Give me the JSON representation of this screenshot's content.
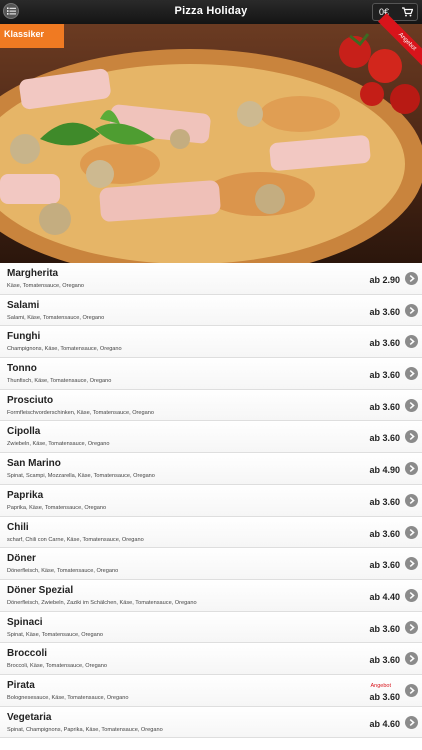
{
  "header": {
    "title": "Pizza Holiday",
    "cart_total": "0€"
  },
  "hero": {
    "category_tab": "Klassiker",
    "ribbon": "Angebot"
  },
  "items": [
    {
      "name": "Margherita",
      "desc": "Käse, Tomatensauce, Oregano",
      "price": "ab 2.90",
      "badge": ""
    },
    {
      "name": "Salami",
      "desc": "Salami, Käse, Tomatensauce, Oregano",
      "price": "ab 3.60",
      "badge": ""
    },
    {
      "name": "Funghi",
      "desc": "Champignons, Käse, Tomatensauce, Oregano",
      "price": "ab 3.60",
      "badge": ""
    },
    {
      "name": "Tonno",
      "desc": "Thunfisch, Käse, Tomatensauce, Oregano",
      "price": "ab 3.60",
      "badge": ""
    },
    {
      "name": "Prosciuto",
      "desc": "Formfleischvorderschinken, Käse, Tomatensauce, Oregano",
      "price": "ab 3.60",
      "badge": ""
    },
    {
      "name": "Cipolla",
      "desc": "Zwiebeln, Käse, Tomatensauce, Oregano",
      "price": "ab 3.60",
      "badge": ""
    },
    {
      "name": "San Marino",
      "desc": "Spinat, Scampi, Mozzarella, Käse, Tomatensauce, Oregano",
      "price": "ab 4.90",
      "badge": ""
    },
    {
      "name": "Paprika",
      "desc": "Paprika, Käse, Tomatensauce, Oregano",
      "price": "ab 3.60",
      "badge": ""
    },
    {
      "name": "Chili",
      "desc": "scharf, Chili con Carne, Käse, Tomatensauce, Oregano",
      "price": "ab 3.60",
      "badge": ""
    },
    {
      "name": "Döner",
      "desc": "Dönerfleisch, Käse, Tomatensauce, Oregano",
      "price": "ab 3.60",
      "badge": ""
    },
    {
      "name": "Döner Spezial",
      "desc": "Dönerfleisch, Zwiebeln, Zaziki im Schälchen, Käse, Tomatensauce, Oregano",
      "price": "ab 4.40",
      "badge": ""
    },
    {
      "name": "Spinaci",
      "desc": "Spinat, Käse, Tomatensauce, Oregano",
      "price": "ab 3.60",
      "badge": ""
    },
    {
      "name": "Broccoli",
      "desc": "Broccoli, Käse, Tomatensauce, Oregano",
      "price": "ab 3.60",
      "badge": ""
    },
    {
      "name": "Pirata",
      "desc": "Bolognesesauce, Käse, Tomatensauce, Oregano",
      "price": "ab 3.60",
      "badge": "Angebot"
    },
    {
      "name": "Vegetaria",
      "desc": "Spinat, Champignons, Paprika, Käse, Tomatensauce, Oregano",
      "price": "ab 4.60",
      "badge": ""
    }
  ],
  "icons": {
    "menu": "list-icon",
    "cart": "cart-icon",
    "row_action": "chevron-right-icon"
  },
  "colors": {
    "header_bg": "#1c1c1c",
    "category_tab": "#f07a22",
    "ribbon": "#d8141b",
    "chevron": "#8b8b8b"
  }
}
